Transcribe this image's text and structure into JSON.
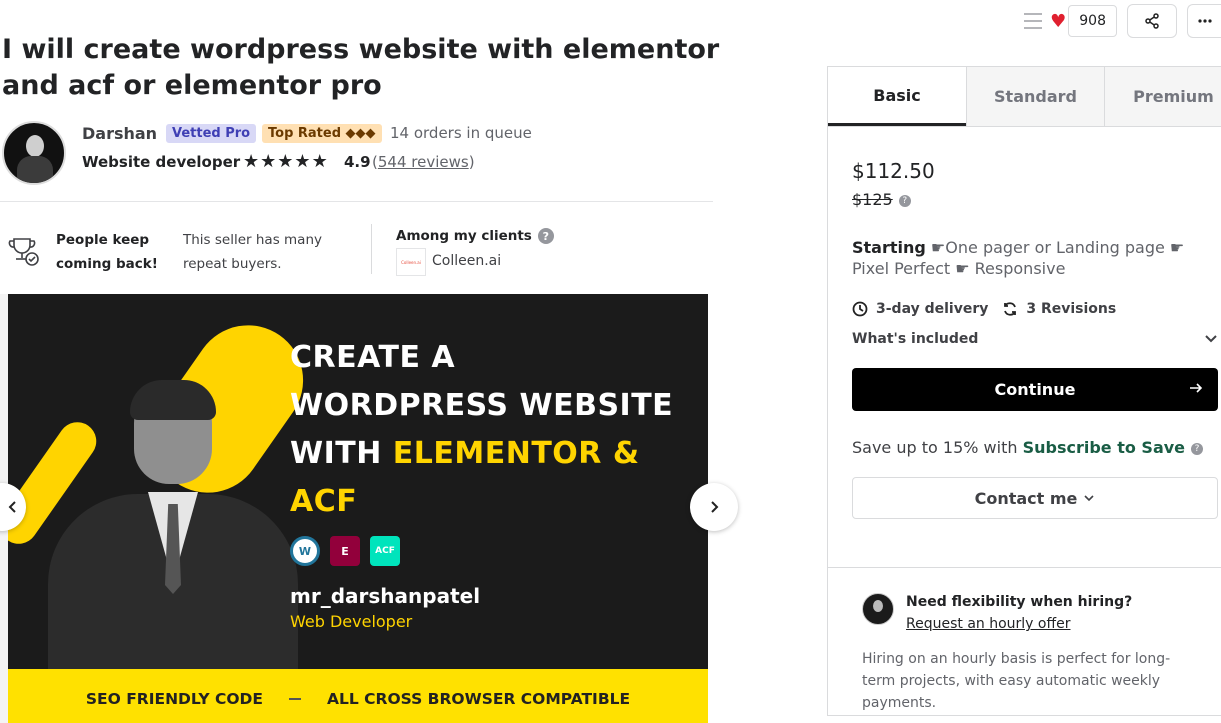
{
  "topbar": {
    "like_count": "908"
  },
  "gig": {
    "title": "I will create wordpress website with elementor and acf or elementor pro"
  },
  "seller": {
    "name": "Darshan",
    "badge_vetted": "Vetted Pro",
    "badge_top": "Top Rated ◆◆◆",
    "orders_queue": "14 orders in queue",
    "title": "Website developer",
    "rating": "4.9",
    "reviews_open": "(",
    "reviews_link": "544 reviews",
    "reviews_close": ")",
    "stars": 5
  },
  "highlights": {
    "keep_label": "People keep coming back!",
    "keep_desc": "This seller has many repeat buyers.",
    "clients_label": "Among my clients",
    "client_name": "Colleen.ai",
    "client_logo": "Colleen.ai"
  },
  "gallery": {
    "line1": "CREATE A",
    "line2": "WORDPRESS WEBSITE",
    "line3_white": "WITH ",
    "line3_yellow": "ELEMENTOR &",
    "line4": "ACF",
    "icon_wp": "W",
    "icon_el": "E",
    "icon_acf": "ACF",
    "handle": "mr_darshanpatel",
    "role": "Web Developer",
    "banner_left": "SEO FRIENDLY CODE",
    "banner_right": "ALL CROSS BROWSER COMPATIBLE"
  },
  "package": {
    "tabs": [
      {
        "label": "Basic"
      },
      {
        "label": "Standard"
      },
      {
        "label": "Premium"
      }
    ],
    "price": "$112.50",
    "old_price": "$125",
    "desc_bold": "Starting",
    "desc_rest": " ☛One pager or Landing page ☛Pixel Perfect ☛ Responsive",
    "delivery": "3-day delivery",
    "revisions": "3 Revisions",
    "included_label": "What's included",
    "continue_label": "Continue",
    "save_prefix": "Save up to 15% with ",
    "save_link": "Subscribe to Save",
    "contact_label": "Contact me"
  },
  "hourly": {
    "title": "Need flexibility when hiring?",
    "link": "Request an hourly offer",
    "text": "Hiring on an hourly basis is perfect for long-term projects, with easy automatic weekly payments."
  },
  "colors": {
    "accent_yellow": "#ffd400",
    "heart": "#e0202f",
    "link_green": "#1a5d45",
    "vetted_bg": "#d8d8f6",
    "top_rated_bg": "#ffe0b3"
  }
}
